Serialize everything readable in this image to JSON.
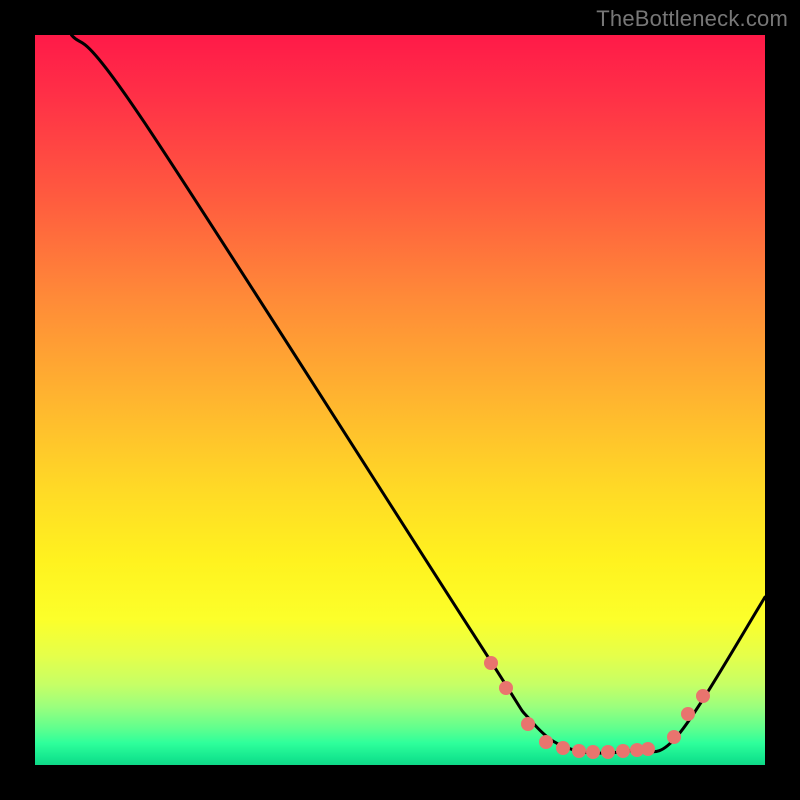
{
  "watermark": "TheBottleneck.com",
  "chart_data": {
    "type": "line",
    "title": "",
    "xlabel": "",
    "ylabel": "",
    "xlim": [
      0,
      100
    ],
    "ylim": [
      0,
      100
    ],
    "grid": false,
    "legend": false,
    "background": "vertical-gradient red→yellow→green",
    "curve": {
      "name": "bottleneck-curve",
      "points_xy": [
        [
          5,
          100
        ],
        [
          15,
          88
        ],
        [
          60,
          18
        ],
        [
          68,
          6
        ],
        [
          74,
          2
        ],
        [
          82,
          2
        ],
        [
          88,
          4
        ],
        [
          100,
          23
        ]
      ]
    },
    "markers": {
      "name": "highlighted-points",
      "color": "#e9746e",
      "points_xy": [
        [
          62.5,
          14.0
        ],
        [
          64.5,
          10.5
        ],
        [
          67.5,
          5.6
        ],
        [
          70.0,
          3.2
        ],
        [
          72.3,
          2.3
        ],
        [
          74.5,
          1.9
        ],
        [
          76.5,
          1.8
        ],
        [
          78.5,
          1.8
        ],
        [
          80.5,
          1.9
        ],
        [
          82.5,
          2.0
        ],
        [
          84.0,
          2.2
        ],
        [
          87.5,
          3.8
        ],
        [
          89.5,
          7.0
        ],
        [
          91.5,
          9.5
        ]
      ]
    }
  }
}
